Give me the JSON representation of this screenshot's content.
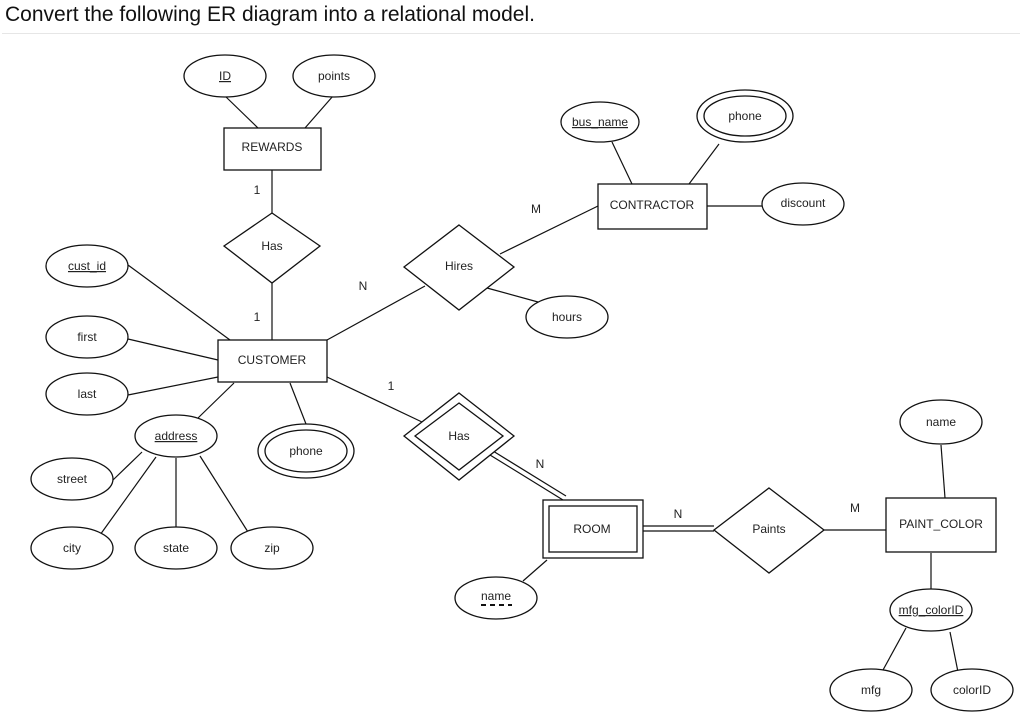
{
  "header": {
    "title": "Convert the following ER diagram into a relational model."
  },
  "diagram": {
    "entities": {
      "rewards": "REWARDS",
      "customer": "CUSTOMER",
      "contractor": "CONTRACTOR",
      "room": "ROOM",
      "paint_color": "PAINT_COLOR"
    },
    "relationships": {
      "has_rewards": "Has",
      "hires": "Hires",
      "has_room": "Has",
      "paints": "Paints"
    },
    "attributes": {
      "rewards_id": "ID",
      "rewards_points": "points",
      "contractor_bus_name": "bus_name",
      "contractor_phone": "phone",
      "contractor_discount": "discount",
      "hires_hours": "hours",
      "customer_cust_id": "cust_id",
      "customer_first": "first",
      "customer_last": "last",
      "customer_address": "address",
      "customer_phone": "phone",
      "address_street": "street",
      "address_city": "city",
      "address_state": "state",
      "address_zip": "zip",
      "room_name": "name",
      "paint_name": "name",
      "paint_mfg_colorID": "mfg_colorID",
      "mfg": "mfg",
      "colorID": "colorID"
    },
    "cardinalities": {
      "rewards_has": "1",
      "customer_has": "1",
      "customer_hires": "N",
      "contractor_hires": "M",
      "customer_has_room": "1",
      "room_has": "N",
      "room_paints": "N",
      "paint_paints": "M"
    }
  }
}
